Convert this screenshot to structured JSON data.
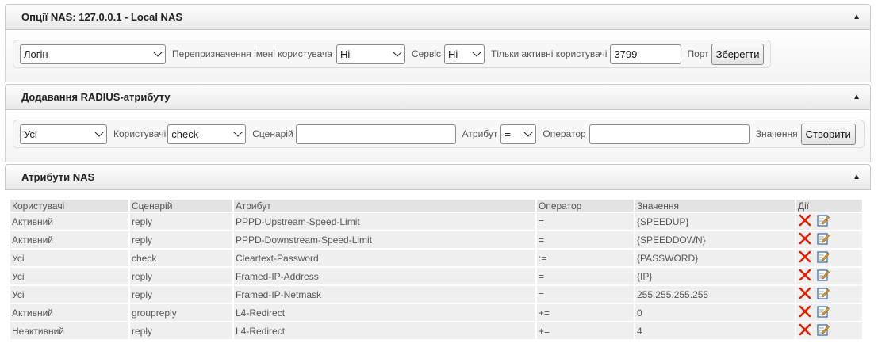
{
  "nas_options": {
    "title": "Опції NAS: 127.0.0.1 - Local NAS",
    "login_select": "Логін",
    "override_label": "Перепризначення імені користувача",
    "override_select": "Ні",
    "service_label": "Сервіс",
    "service_select": "Ні",
    "active_only_label": "Тільки активні користувачі",
    "port_value": "3799",
    "port_label": "Порт",
    "save_button": "Зберегти"
  },
  "add_attr": {
    "title": "Додавання RADIUS-атрибуту",
    "users_select": "Усі",
    "users_label": "Користувачі",
    "scenario_select": "check",
    "scenario_label": "Сценарій",
    "scenario_value": "",
    "attribute_label": "Атрибут",
    "operator_select": "=",
    "operator_label": "Оператор",
    "operator_value": "",
    "value_label": "Значення",
    "create_button": "Створити"
  },
  "nas_attrs": {
    "title": "Атрибути NAS",
    "columns": [
      "Користувачі",
      "Сценарій",
      "Атрибут",
      "Оператор",
      "Значення",
      "Дії"
    ],
    "rows": [
      [
        "Активний",
        "reply",
        "PPPD-Upstream-Speed-Limit",
        "=",
        "{SPEEDUP}"
      ],
      [
        "Активний",
        "reply",
        "PPPD-Downstream-Speed-Limit",
        "=",
        "{SPEEDDOWN}"
      ],
      [
        "Усі",
        "check",
        "Cleartext-Password",
        ":=",
        "{PASSWORD}"
      ],
      [
        "Усі",
        "reply",
        "Framed-IP-Address",
        "=",
        "{IP}"
      ],
      [
        "Усі",
        "reply",
        "Framed-IP-Netmask",
        "=",
        "255.255.255.255"
      ],
      [
        "Активний",
        "groupreply",
        "L4-Redirect",
        "+=",
        "0"
      ],
      [
        "Неактивний",
        "reply",
        "L4-Redirect",
        "+=",
        "4"
      ]
    ]
  },
  "icons": {
    "collapse": "triangle-up-icon",
    "delete": "red-cross-icon",
    "edit": "edit-pencil-icon"
  },
  "colors": {
    "delete": "#dd2200",
    "edit_blue": "#3366aa",
    "edit_pencil": "#e8a020"
  }
}
